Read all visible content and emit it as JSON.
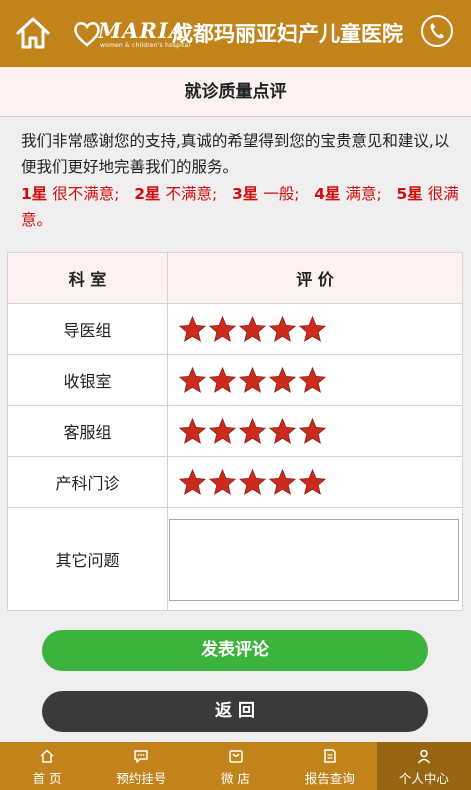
{
  "header": {
    "logo_text": "MARIA",
    "logo_subtext": "women & children's hospital",
    "hospital_name": "成都玛丽亚妇产儿童医院"
  },
  "page": {
    "title": "就诊质量点评",
    "intro": "我们非常感谢您的支持,真诚的希望得到您的宝贵意见和建议,以便我们更好地完善我们的服务。",
    "legend": [
      {
        "stars": "1星",
        "label": "很不满意;"
      },
      {
        "stars": "2星",
        "label": "不满意;"
      },
      {
        "stars": "3星",
        "label": "一般;"
      },
      {
        "stars": "4星",
        "label": "满意;"
      },
      {
        "stars": "5星",
        "label": "很满意。"
      }
    ]
  },
  "table": {
    "header_dept": "科 室",
    "header_rating": "评 价",
    "rows": [
      {
        "dept": "导医组",
        "rating": 5
      },
      {
        "dept": "收银室",
        "rating": 5
      },
      {
        "dept": "客服组",
        "rating": 5
      },
      {
        "dept": "产科门诊",
        "rating": 5
      }
    ],
    "other_label": "其它问题",
    "other_value": ""
  },
  "buttons": {
    "submit": "发表评论",
    "back": "返 回"
  },
  "tabbar": {
    "items": [
      {
        "label": "首 页",
        "icon": "home-icon"
      },
      {
        "label": "预约挂号",
        "icon": "chat-icon"
      },
      {
        "label": "微 店",
        "icon": "shop-icon"
      },
      {
        "label": "报告查询",
        "icon": "report-icon"
      },
      {
        "label": "个人中心",
        "icon": "user-icon",
        "active": true
      }
    ]
  },
  "colors": {
    "brand": "#c2841a",
    "brand_dark": "#986612",
    "accent_red": "#d20d0d",
    "star": "#cc2a1c",
    "submit_green": "#3cb43c",
    "back_dark": "#3a3a3a"
  }
}
